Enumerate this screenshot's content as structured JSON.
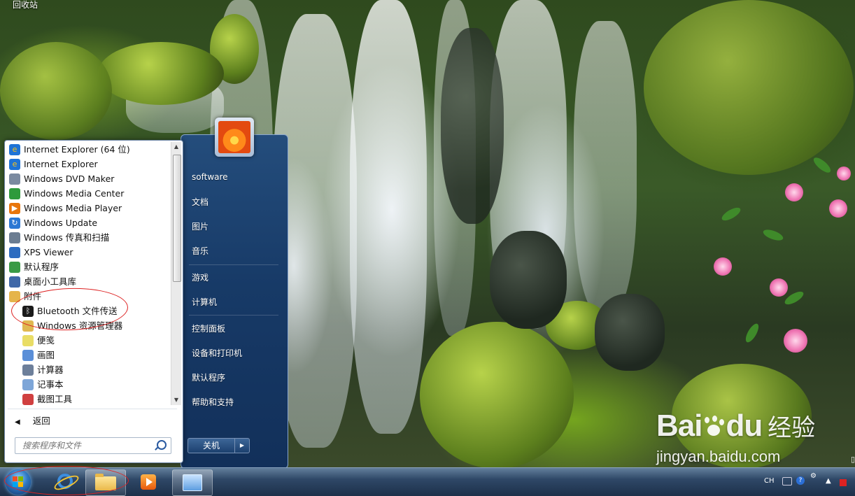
{
  "desktop": {
    "recycle_bin": "回收站",
    "watermark_cn": "经验",
    "watermark_url": "jingyan.baidu.com"
  },
  "start_menu": {
    "programs": [
      {
        "label": "Internet Explorer (64 位)",
        "icon": "ie-icon",
        "sub": false
      },
      {
        "label": "Internet Explorer",
        "icon": "ie-icon",
        "sub": false
      },
      {
        "label": "Windows DVD Maker",
        "icon": "dvd-maker-icon",
        "sub": false
      },
      {
        "label": "Windows Media Center",
        "icon": "media-center-icon",
        "sub": false
      },
      {
        "label": "Windows Media Player",
        "icon": "media-player-icon",
        "sub": false
      },
      {
        "label": "Windows Update",
        "icon": "update-icon",
        "sub": false
      },
      {
        "label": "Windows 传真和扫描",
        "icon": "fax-scan-icon",
        "sub": false
      },
      {
        "label": "XPS Viewer",
        "icon": "xps-viewer-icon",
        "sub": false
      },
      {
        "label": "默认程序",
        "icon": "default-programs-icon",
        "sub": false
      },
      {
        "label": "桌面小工具库",
        "icon": "gadgets-icon",
        "sub": false
      },
      {
        "label": "附件",
        "icon": "folder-icon",
        "sub": false
      },
      {
        "label": "Bluetooth 文件传送",
        "icon": "bluetooth-icon",
        "sub": true
      },
      {
        "label": "Windows 资源管理器",
        "icon": "explorer-icon",
        "sub": true
      },
      {
        "label": "便笺",
        "icon": "sticky-notes-icon",
        "sub": true
      },
      {
        "label": "画图",
        "icon": "paint-icon",
        "sub": true
      },
      {
        "label": "计算器",
        "icon": "calculator-icon",
        "sub": true
      },
      {
        "label": "记事本",
        "icon": "notepad-icon",
        "sub": true
      },
      {
        "label": "截图工具",
        "icon": "snipping-tool-icon",
        "sub": true
      }
    ],
    "back_label": "返回",
    "search_placeholder": "搜索程序和文件",
    "right_items": [
      "software",
      "文档",
      "图片",
      "音乐",
      "游戏",
      "计算机",
      "控制面板",
      "设备和打印机",
      "默认程序",
      "帮助和支持"
    ],
    "shutdown_label": "关机"
  },
  "taskbar": {
    "language": "CH"
  },
  "colors": {
    "start_right_pane": "#173a67",
    "annotation_red": "#dd2222",
    "taskbar": "#1c2c46"
  }
}
